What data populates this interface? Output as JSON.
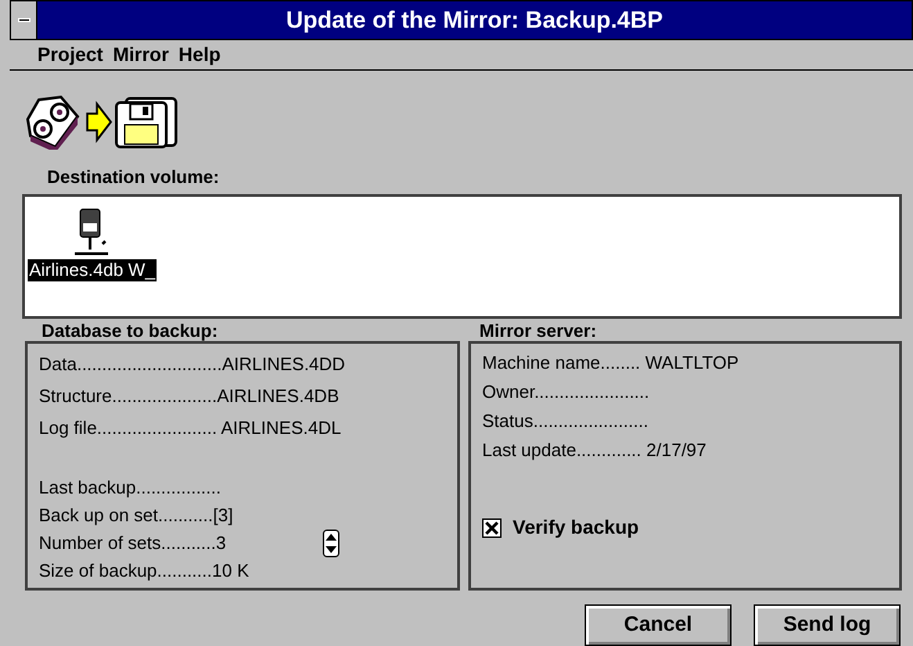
{
  "window": {
    "title": "Update of the Mirror: Backup.4BP"
  },
  "menu": [
    "Project",
    "Mirror",
    "Help"
  ],
  "destination": {
    "label": "Destination volume:",
    "volume": "Airlines.4db W_",
    "selected": true
  },
  "database": {
    "label": "Database to backup:",
    "files": [
      "Data.............................AIRLINES.4DD",
      "Structure.....................AIRLINES.4DB",
      "Log file........................ AIRLINES.4DL"
    ],
    "info": [
      "Last backup.................",
      "Back up on set...........[3]",
      "Number of sets...........3",
      "Size of backup...........10 K"
    ]
  },
  "mirror": {
    "label": "Mirror server:",
    "rows": [
      "Machine name........  WALTLTOP",
      "Owner.......................",
      "Status.......................",
      "Last update............. 2/17/97"
    ],
    "verify": {
      "label": "Verify backup",
      "checked": true
    }
  },
  "buttons": [
    "Cancel",
    "Send log"
  ]
}
